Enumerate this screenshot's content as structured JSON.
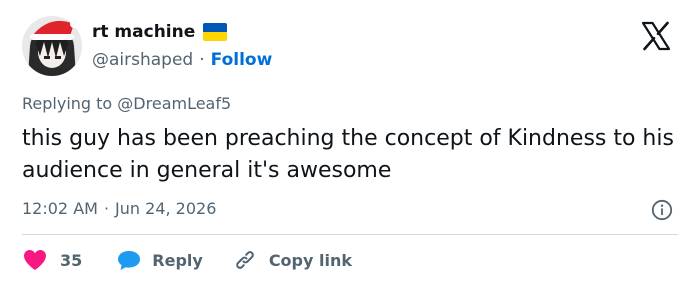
{
  "author": {
    "display_name": "rt machine",
    "handle": "@airshaped",
    "follow_label": "Follow",
    "flag_colors": [
      "#0057b8",
      "#ffd700"
    ]
  },
  "reply_context": {
    "prefix": "Replying to",
    "mention": "@DreamLeaf5"
  },
  "tweet": {
    "text": "this guy has been preaching the concept of Kindness to his audience in general it's awesome",
    "time": "12:02 AM",
    "separator": "·",
    "date": "Jun 24, 2026"
  },
  "actions": {
    "like_count": "35",
    "reply_label": "Reply",
    "copy_link_label": "Copy link"
  },
  "colors": {
    "like": "#f91880",
    "reply": "#1d9bf0",
    "link": "#006fd6",
    "muted": "#536471"
  },
  "icons": {
    "platform": "x-logo-icon",
    "info": "info-icon",
    "like": "heart-icon",
    "reply": "speech-bubble-icon",
    "copy": "link-icon"
  }
}
